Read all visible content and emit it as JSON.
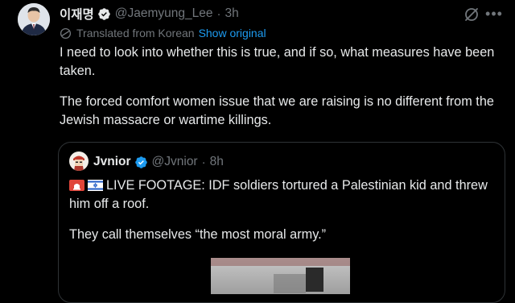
{
  "tweet": {
    "author_name": "이재명",
    "handle": "@Jaemyung_Lee",
    "separator": "·",
    "time": "3h",
    "translated_label": "Translated from Korean",
    "show_original": "Show original",
    "paragraphs": [
      "I need to look into whether this is true, and if so, what measures have been taken.",
      "The forced comfort women issue that we are raising is no different from the Jewish massacre or wartime killings."
    ]
  },
  "quote": {
    "author_name": "Jvnior",
    "handle": "@Jvnior",
    "separator": "·",
    "time": "8h",
    "headline": "LIVE FOOTAGE: IDF soldiers tortured a Palestinian kid and threw him off a roof.",
    "paragraph2": "They call themselves “the most moral army.”"
  },
  "icons": {
    "verified": "verified-badge-icon",
    "grok": "grok-icon",
    "more": "more-icon",
    "translate": "globe-icon"
  },
  "colors": {
    "background": "#000000",
    "text": "#e7e9ea",
    "muted": "#71767b",
    "link": "#1d9bf0",
    "border": "#2f3336"
  }
}
